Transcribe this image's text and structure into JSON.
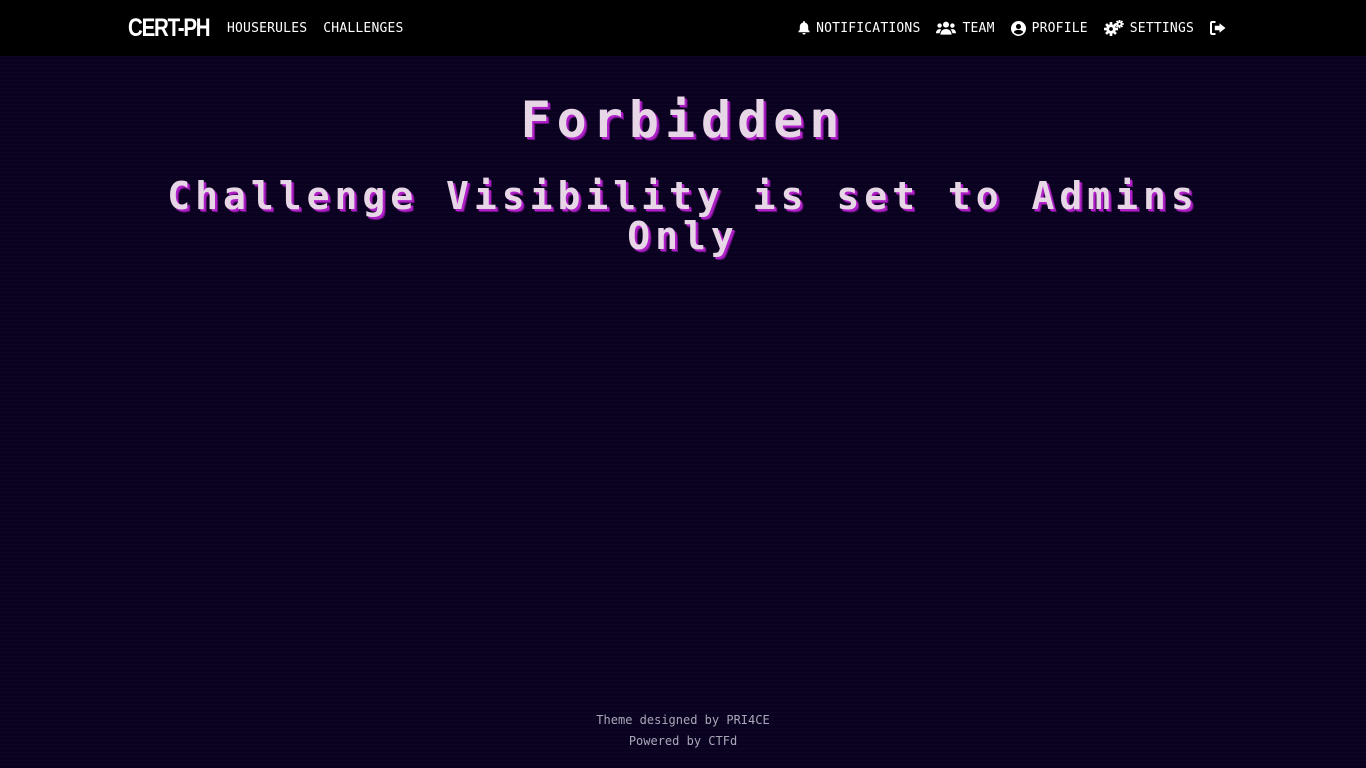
{
  "navbar": {
    "brand": "CERT-PH",
    "left_links": [
      {
        "label": "HOUSERULES"
      },
      {
        "label": "CHALLENGES"
      }
    ],
    "right_links": [
      {
        "label": "NOTIFICATIONS",
        "icon": "bell-icon"
      },
      {
        "label": "TEAM",
        "icon": "users-icon"
      },
      {
        "label": "PROFILE",
        "icon": "user-circle-icon"
      },
      {
        "label": "SETTINGS",
        "icon": "gears-icon"
      }
    ],
    "logout_icon": "sign-out-icon"
  },
  "main": {
    "title": "Forbidden",
    "message": "Challenge Visibility is set to Admins Only"
  },
  "footer": {
    "theme_credit": "Theme designed by PRI4CE",
    "powered_by": "Powered by CTFd"
  },
  "colors": {
    "background": "#0a0020",
    "navbar": "#000000",
    "text": "#e6d6e6",
    "text_shadow": "#b020c8",
    "footer_text": "#a8a8b8"
  }
}
